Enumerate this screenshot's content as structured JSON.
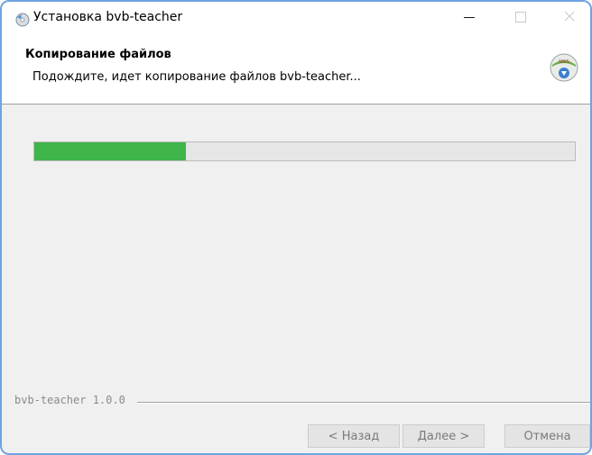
{
  "window": {
    "title": "Установка bvb-teacher",
    "icons": {
      "app": "installer-disc-icon",
      "minimize": "minimize-icon",
      "maximize": "maximize-icon",
      "close": "close-icon",
      "header": "setup-disc-download-icon"
    }
  },
  "header": {
    "title": "Копирование файлов",
    "subtitle": "Подождите, идет копирование файлов bvb-teacher...",
    "icon_badge": "NSIS"
  },
  "progress": {
    "value_percent": 28,
    "fill_color": "#3fb54a"
  },
  "footer": {
    "version": "bvb-teacher 1.0.0"
  },
  "buttons": {
    "back": "< Назад",
    "next": "Далее >",
    "cancel": "Отмена"
  },
  "colors": {
    "window_border": "#6ea4e0",
    "body_bg": "#f0f0f0"
  }
}
